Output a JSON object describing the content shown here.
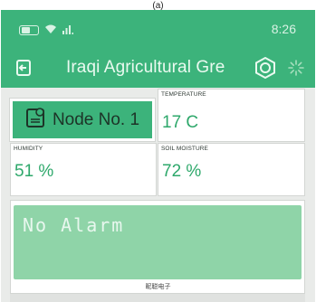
{
  "caption": "(a)",
  "status_bar": {
    "time": "8:26"
  },
  "app_bar": {
    "title": "Iraqi Agricultural Gre"
  },
  "node_button": {
    "label": "Node No. 1"
  },
  "widgets": {
    "temperature": {
      "label": "TEMPERATURE",
      "value": "17 C"
    },
    "humidity": {
      "label": "HUMIDITY",
      "value": "51 %"
    },
    "soil_moisture": {
      "label": "SOIL MOISTURE",
      "value": "72 %"
    }
  },
  "lcd": {
    "text": "No Alarm",
    "footer": "昵聪电子"
  },
  "colors": {
    "brand_green": "#3cb37b",
    "value_green": "#2ea86b",
    "lcd_green": "#8fd4a8"
  }
}
